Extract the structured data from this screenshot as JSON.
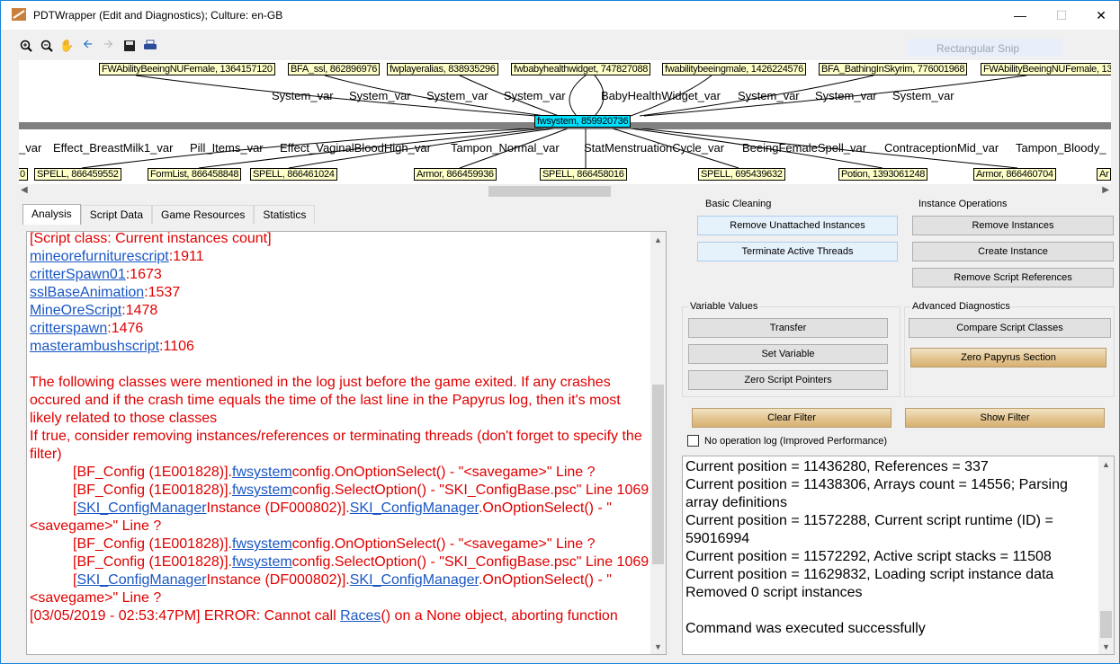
{
  "window": {
    "title": "PDTWrapper (Edit and Diagnostics); Culture: en-GB"
  },
  "snip_overlay": "Rectangular Snip",
  "toolbar_icons": [
    "zoom-in-icon",
    "zoom-out-icon",
    "pan-hand-icon",
    "back-arrow-icon",
    "forward-arrow-icon",
    "save-icon",
    "print-icon"
  ],
  "graph": {
    "center_node": "fwsystem, 859920736",
    "top_nodes": [
      "FWAbilityBeeingNUFemale, 1364157120",
      "BFA_ssl, 862896976",
      "fwplayeralias, 838935296",
      "fwbabyhealthwidget, 747827088",
      "fwabilitybeeingmale, 1426224576",
      "BFA_BathingInSkyrim, 776001968",
      "FWAbilityBeeingNUFemale, 13"
    ],
    "top_edge_labels": [
      "System_var",
      "System_var",
      "System_var",
      "System_var",
      "BabyHealthWidget_var",
      "System_var",
      "System_var",
      "System_var"
    ],
    "bottom_edge_labels": [
      "_var",
      "Effect_BreastMilk1_var",
      "Pill_Items_var",
      "Effect_VaginalBloodHigh_var",
      "Tampon_Normal_var",
      "StatMenstruationCycle_var",
      "BeeingFemaleSpell_var",
      "ContraceptionMid_var",
      "Tampon_Bloody_"
    ],
    "bottom_nodes": [
      "0",
      "SPELL, 866459552",
      "FormList, 866458848",
      "SPELL, 866461024",
      "Armor, 866459936",
      "SPELL, 866458016",
      "SPELL, 695439632",
      "Potion, 1393061248",
      "Armor, 866460704",
      "Ar"
    ]
  },
  "tabs": [
    "Analysis",
    "Script Data",
    "Game Resources",
    "Statistics"
  ],
  "log": {
    "header": "[Script class: Current instances count]",
    "counts": [
      {
        "name": "mineorefurniturescript",
        "value": ":1911"
      },
      {
        "name": "critterSpawn01",
        "value": ":1673"
      },
      {
        "name": "sslBaseAnimation",
        "value": ":1537"
      },
      {
        "name": "MineOreScript",
        "value": ":1478"
      },
      {
        "name": "critterspawn",
        "value": ":1476"
      },
      {
        "name": "masterambushscript",
        "value": ":1106"
      }
    ],
    "para1": "The following classes were mentioned in the log just before the game exited. If any crashes occured and if the crash time equals the time of the last line in the Papyrus log, then it's most likely related to those classes",
    "para2": "If true, consider removing instances/references or terminating threads (don't forget to specify the filter)",
    "line_bf_pre": "[BF_Config (1E001828)].",
    "link_fwsystem": "fwsystem",
    "line_bf_opt": "config.OnOptionSelect() - \"<savegame>\" Line ?",
    "line_bf_sel": "config.SelectOption() - \"SKI_ConfigBase.psc\" Line 1069",
    "line_ski_pre": "[",
    "link_ski": "SKI_ConfigManager",
    "line_ski_mid": "Instance (DF000802)].",
    "line_ski_post": ".OnOptionSelect() - \"<savegame>\" Line ?",
    "last_pre": "[03/05/2019 - 02:53:47PM] ERROR: Cannot call ",
    "last_link": "Races",
    "last_post": "() on a None object, aborting function"
  },
  "groups": {
    "basic_cleaning": "Basic Cleaning",
    "instance_operations": "Instance Operations",
    "variable_values": "Variable Values",
    "advanced_diagnostics": "Advanced Diagnostics"
  },
  "buttons": {
    "remove_unattached": "Remove Unattached Instances",
    "terminate_threads": "Terminate Active Threads",
    "remove_instances": "Remove Instances",
    "create_instance": "Create Instance",
    "remove_script_refs": "Remove Script References",
    "transfer": "Transfer",
    "set_variable": "Set Variable",
    "zero_script_pointers": "Zero Script Pointers",
    "compare_script_classes": "Compare Script Classes",
    "zero_papyrus_section": "Zero Papyrus Section",
    "clear_filter": "Clear Filter",
    "show_filter": "Show Filter"
  },
  "no_op_log": {
    "label": "No operation log (Improved Performance)",
    "checked": false
  },
  "output": [
    "Current position = 11436280, References = 337",
    "Current position = 11438306, Arrays count = 14556; Parsing array definitions",
    "Current position = 11572288, Current script runtime (ID) = 59016994",
    "Current position = 11572292, Active script stacks = 11508",
    "Current position = 11629832, Loading script instance data",
    "Removed 0 script instances",
    "",
    "Command was executed successfully"
  ]
}
